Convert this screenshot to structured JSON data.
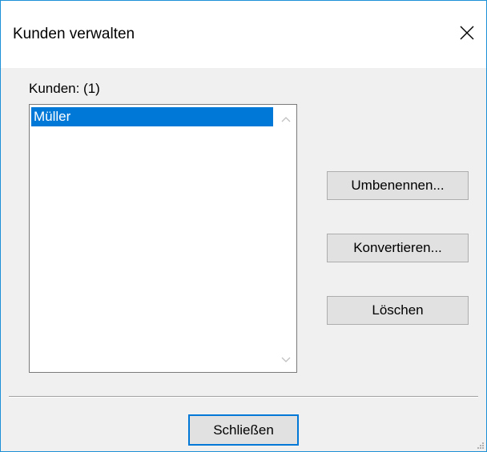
{
  "window": {
    "title": "Kunden verwalten"
  },
  "customers": {
    "label": "Kunden: (1)",
    "items": [
      {
        "name": "Müller",
        "selected": true
      }
    ]
  },
  "actions": {
    "rename_label": "Umbenennen...",
    "convert_label": "Konvertieren...",
    "delete_label": "Löschen"
  },
  "footer": {
    "close_label": "Schließen"
  },
  "icons": {
    "close": "close-icon",
    "scroll_up": "chevron-up-icon",
    "scroll_down": "chevron-down-icon",
    "grip": "resize-grip-icon"
  },
  "colors": {
    "accent": "#0078d7",
    "window_border": "#1e90d6",
    "dialog_bg": "#f0f0f0",
    "button_bg": "#e1e1e1"
  }
}
